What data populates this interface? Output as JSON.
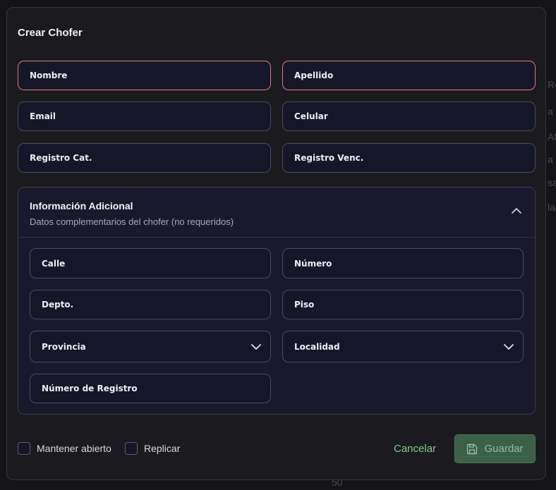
{
  "background_fragments": [
    "Re",
    "a",
    "AB",
    "a",
    "sa",
    "la",
    "50"
  ],
  "modal": {
    "title": "Crear Chofer",
    "fields": {
      "nombre": "Nombre",
      "apellido": "Apellido",
      "email": "Email",
      "celular": "Celular",
      "registro_cat": "Registro Cat.",
      "registro_venc": "Registro Venc."
    },
    "additional": {
      "title": "Información Adicional",
      "subtitle": "Datos complementarios del chofer (no requeridos)",
      "expanded": true,
      "fields": {
        "calle": "Calle",
        "numero": "Número",
        "depto": "Depto.",
        "piso": "Piso",
        "provincia": "Provincia",
        "localidad": "Localidad",
        "numero_registro": "Número de Registro"
      }
    },
    "footer": {
      "keep_open_label": "Mantener abierto",
      "replicate_label": "Replicar",
      "cancel_label": "Cancelar",
      "save_label": "Guardar"
    }
  },
  "colors": {
    "accent_green": "#7fcf8a",
    "error_border": "#e2787d",
    "save_bg": "#3b6048"
  }
}
